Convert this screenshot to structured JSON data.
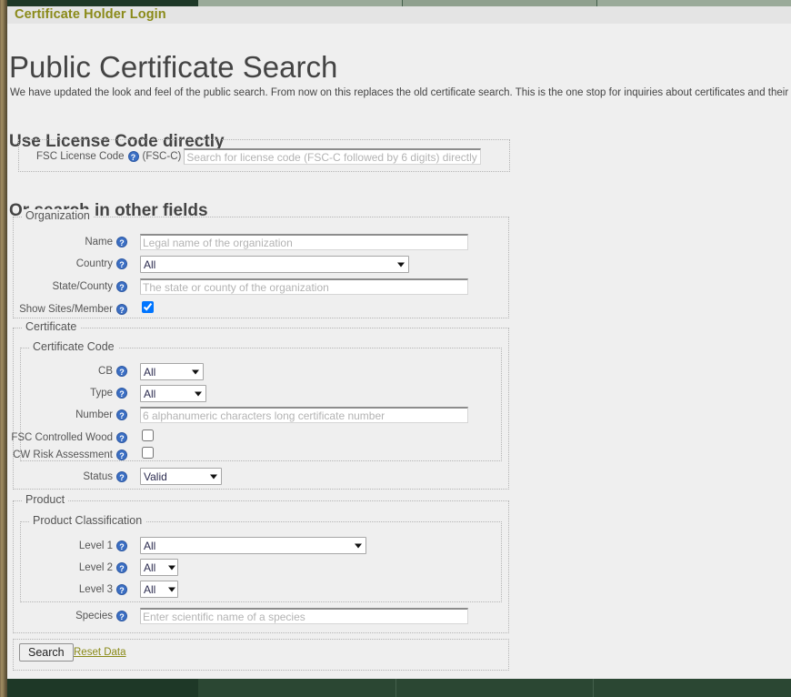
{
  "header": {
    "login_link": "Certificate Holder Login"
  },
  "page_title": "Public Certificate Search",
  "intro": "We have updated the look and feel of the public search. From now on this replaces the old certificate search. This is the one stop for inquiries about certificates and their status.",
  "help_glyph": "?",
  "license_section": {
    "heading": "Use License Code directly",
    "label": "FSC License Code",
    "suffix": "(FSC-C)",
    "placeholder": "Search for license code (FSC-C followed by 6 digits) directly",
    "value": ""
  },
  "other_section": {
    "heading": "Or search in other fields"
  },
  "organization": {
    "legend": "Organization",
    "name": {
      "label": "Name",
      "placeholder": "Legal name of the organization",
      "value": ""
    },
    "country": {
      "label": "Country",
      "value": "All",
      "options": [
        "All"
      ]
    },
    "state": {
      "label": "State/County",
      "placeholder": "The state or county of the organization",
      "value": ""
    },
    "show_sites": {
      "label": "Show Sites/Member",
      "checked": true
    }
  },
  "certificate": {
    "legend": "Certificate",
    "code_legend": "Certificate Code",
    "cb": {
      "label": "CB",
      "value": "All",
      "options": [
        "All"
      ]
    },
    "type": {
      "label": "Type",
      "value": "All",
      "options": [
        "All"
      ]
    },
    "number": {
      "label": "Number",
      "placeholder": "6 alphanumeric characters long certificate number",
      "value": ""
    },
    "controlled_wood": {
      "label": "FSC Controlled Wood",
      "checked": false
    },
    "risk_assessment": {
      "label": "CW Risk Assessment",
      "checked": false
    },
    "status": {
      "label": "Status",
      "value": "Valid",
      "options": [
        "Valid"
      ]
    }
  },
  "product": {
    "legend": "Product",
    "classification_legend": "Product Classification",
    "level1": {
      "label": "Level 1",
      "value": "All",
      "options": [
        "All"
      ]
    },
    "level2": {
      "label": "Level 2",
      "value": "All",
      "options": [
        "All"
      ]
    },
    "level3": {
      "label": "Level 3",
      "value": "All",
      "options": [
        "All"
      ]
    },
    "species": {
      "label": "Species",
      "placeholder": "Enter scientific name of a species",
      "value": ""
    }
  },
  "actions": {
    "search_label": "Search",
    "reset_label": "Reset Data"
  },
  "colors": {
    "accent_olive": "#8a8a18",
    "help_blue": "#3b6fc4",
    "footer_green": "#2b4733",
    "footer_green_dark": "#1e3827"
  }
}
